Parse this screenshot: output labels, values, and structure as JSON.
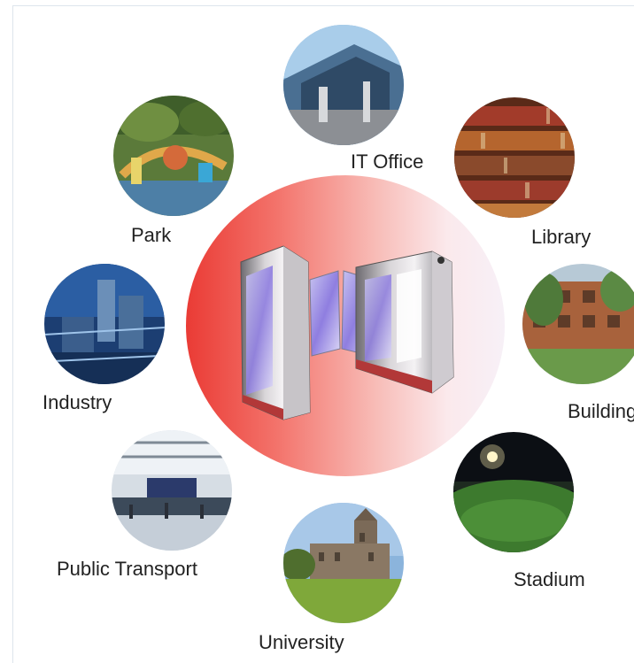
{
  "center": {
    "graphic": "turnstile-gate",
    "gradient": [
      "#ea3b35",
      "#f8bdb8",
      "#f7f0f7"
    ]
  },
  "applications": [
    {
      "key": "it_office",
      "label": "IT Office",
      "icon": "office-building-photo"
    },
    {
      "key": "park",
      "label": "Park",
      "icon": "park-photo"
    },
    {
      "key": "library",
      "label": "Library",
      "icon": "library-photo"
    },
    {
      "key": "industry",
      "label": "Industry",
      "icon": "industry-photo"
    },
    {
      "key": "building",
      "label": "Building",
      "icon": "residential-building-photo"
    },
    {
      "key": "public_transport",
      "label": "Public Transport",
      "icon": "transport-station-photo"
    },
    {
      "key": "stadium",
      "label": "Stadium",
      "icon": "stadium-photo"
    },
    {
      "key": "university",
      "label": "University",
      "icon": "university-photo"
    }
  ]
}
